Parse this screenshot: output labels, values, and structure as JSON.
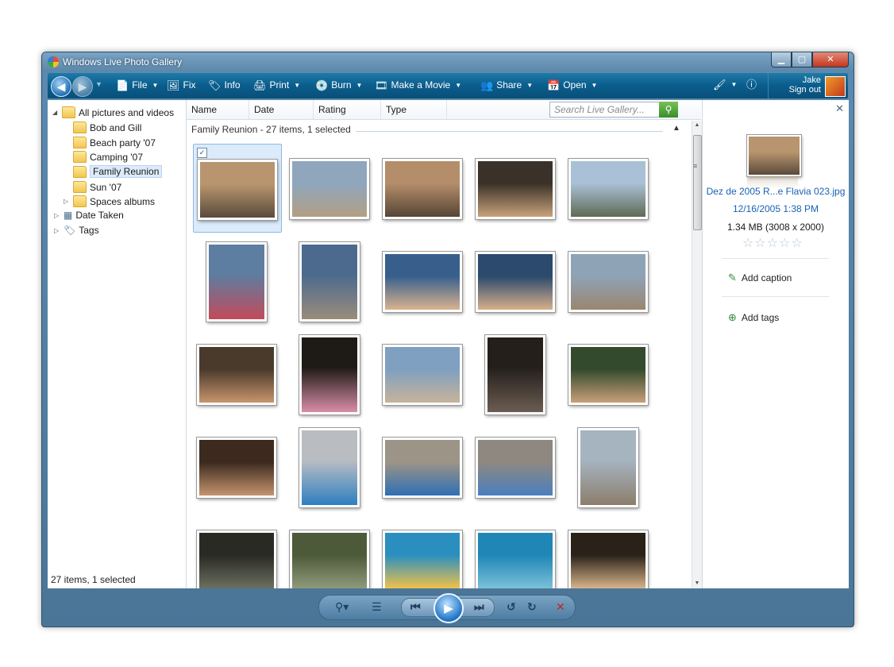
{
  "window": {
    "title": "Windows Live Photo Gallery"
  },
  "toolbar": {
    "file": "File",
    "fix": "Fix",
    "info": "Info",
    "print": "Print",
    "burn": "Burn",
    "make_movie": "Make a Movie",
    "share": "Share",
    "open": "Open",
    "user_name": "Jake",
    "sign_out": "Sign out",
    "icons": [
      "back-arrow-icon",
      "forward-arrow-icon",
      "file-icon",
      "fix-icon",
      "info-icon",
      "printer-icon",
      "burn-disc-icon",
      "movie-icon",
      "share-icon",
      "open-icon",
      "paintbrush-icon",
      "help-icon"
    ]
  },
  "tree": {
    "root": "All pictures and videos",
    "folders": [
      "Bob and Gill",
      "Beach party '07",
      "Camping '07",
      "Family Reunion",
      "Sun '07",
      "Spaces albums"
    ],
    "selected": "Family Reunion",
    "date_taken": "Date Taken",
    "tags": "Tags"
  },
  "status": {
    "left": "27 items, 1 selected"
  },
  "columns": {
    "name": "Name",
    "date": "Date",
    "rating": "Rating",
    "type": "Type"
  },
  "search": {
    "placeholder": "Search Live Gallery..."
  },
  "group": {
    "title": "Family Reunion - 27 items, 1 selected"
  },
  "photos": [
    {
      "colors": [
        "#b8956e",
        "#5a4a3c"
      ],
      "portrait": false,
      "selected": true
    },
    {
      "colors": [
        "#8fa6bd",
        "#b39f84"
      ],
      "portrait": false
    },
    {
      "colors": [
        "#b48d6a",
        "#574536"
      ],
      "portrait": false
    },
    {
      "colors": [
        "#3a3228",
        "#c9a27c"
      ],
      "portrait": false
    },
    {
      "colors": [
        "#a9c0d6",
        "#5f6b55"
      ],
      "portrait": false
    },
    {
      "colors": [
        "#5d7da1",
        "#c24a5a"
      ],
      "portrait": true
    },
    {
      "colors": [
        "#4c6a8e",
        "#9a8c7a"
      ],
      "portrait": true
    },
    {
      "colors": [
        "#385f8c",
        "#d9b38f"
      ],
      "portrait": false
    },
    {
      "colors": [
        "#2b4a6e",
        "#d7b08a"
      ],
      "portrait": false
    },
    {
      "colors": [
        "#8ea3b5",
        "#9b8570"
      ],
      "portrait": false
    },
    {
      "colors": [
        "#4a3a2c",
        "#c8956c"
      ],
      "portrait": false
    },
    {
      "colors": [
        "#1e1a16",
        "#d98ea8"
      ],
      "portrait": true
    },
    {
      "colors": [
        "#7fa0c0",
        "#c7b39a"
      ],
      "portrait": false
    },
    {
      "colors": [
        "#241f1b",
        "#6c5d52"
      ],
      "portrait": true
    },
    {
      "colors": [
        "#334b2c",
        "#c8a07a"
      ],
      "portrait": false
    },
    {
      "colors": [
        "#3c2a1e",
        "#c59470"
      ],
      "portrait": false
    },
    {
      "colors": [
        "#b9bdc2",
        "#2e7fc0"
      ],
      "portrait": true
    },
    {
      "colors": [
        "#9c9486",
        "#2f6fb4"
      ],
      "portrait": false
    },
    {
      "colors": [
        "#8e8880",
        "#4b7fbf"
      ],
      "portrait": false
    },
    {
      "colors": [
        "#a6b4c0",
        "#8c7e6c"
      ],
      "portrait": true
    },
    {
      "colors": [
        "#2a2a24",
        "#6a7060"
      ],
      "portrait": false
    },
    {
      "colors": [
        "#4d5a3a",
        "#8f9a7a"
      ],
      "portrait": false
    },
    {
      "colors": [
        "#2a8fbf",
        "#f0c14a"
      ],
      "portrait": false
    },
    {
      "colors": [
        "#1f86b6",
        "#7bc0d9"
      ],
      "portrait": false
    },
    {
      "colors": [
        "#2a2218",
        "#d9b48c"
      ],
      "portrait": false
    }
  ],
  "details": {
    "filename": "Dez de 2005 R...e Flavia 023.jpg",
    "datetime": "12/16/2005   1:38 PM",
    "size": "1.34 MB (3008 x 2000)",
    "rating_stars": 0,
    "add_caption": "Add caption",
    "add_tags": "Add tags"
  },
  "bottom": {
    "icons": [
      "zoom-icon",
      "slideshow-list-icon",
      "previous-icon",
      "play-icon",
      "next-icon",
      "rotate-left-icon",
      "rotate-right-icon",
      "delete-icon"
    ]
  }
}
